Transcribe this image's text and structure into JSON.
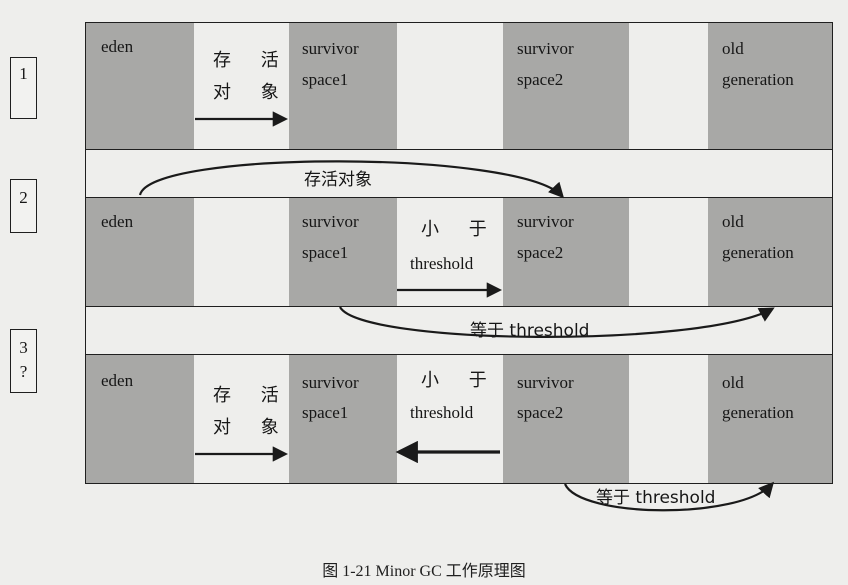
{
  "stages": [
    {
      "marker": [
        "1"
      ],
      "cells": {
        "eden": "eden",
        "survivor1": [
          "survivor",
          "space1"
        ],
        "survivor2": [
          "survivor",
          "space2"
        ],
        "old": [
          "old",
          "generation"
        ]
      },
      "mid_left": [
        "存 活",
        "对 象"
      ],
      "mid_right": []
    },
    {
      "marker": [
        "2"
      ],
      "cells": {
        "eden": "eden",
        "survivor1": [
          "survivor",
          "space1"
        ],
        "survivor2": [
          "survivor",
          "space2"
        ],
        "old": [
          "old",
          "generation"
        ]
      },
      "mid_left": [],
      "mid_right": [
        "小 于",
        "threshold"
      ],
      "arc_top_label": "存活对象",
      "arc_bottom_label": "等于 threshold"
    },
    {
      "marker": [
        "3",
        "?"
      ],
      "cells": {
        "eden": "eden",
        "survivor1": [
          "survivor",
          "space1"
        ],
        "survivor2": [
          "survivor",
          "space2"
        ],
        "old": [
          "old",
          "generation"
        ]
      },
      "mid_left": [
        "存 活",
        "对 象"
      ],
      "mid_right": [
        "小 于",
        "threshold"
      ],
      "arc_bottom_label": "等于 threshold"
    }
  ],
  "caption": "图 1-21    Minor GC 工作原理图"
}
